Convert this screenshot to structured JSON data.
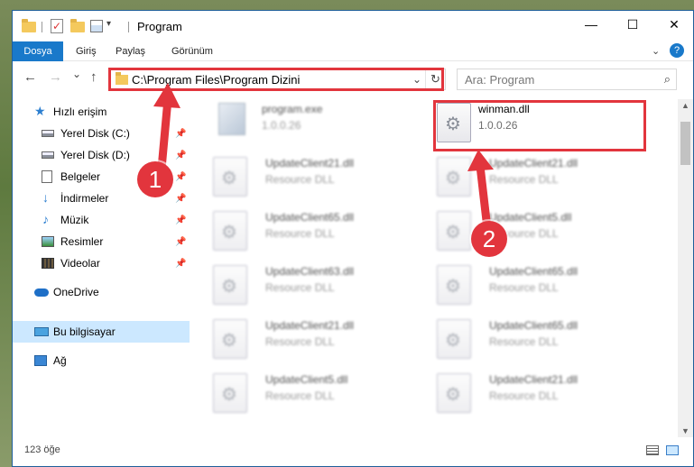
{
  "window": {
    "title": "Program",
    "minimize": "—",
    "maximize": "☐",
    "close": "✕"
  },
  "ribbon": {
    "tabs": [
      "Dosya",
      "Giriş",
      "Paylaş",
      "Görünüm"
    ],
    "help": "?"
  },
  "navigation": {
    "back": "←",
    "forward": "→",
    "recent": "⌄",
    "up": "↑",
    "address": "C:\\Program Files\\Program Dizini",
    "refresh": "↻",
    "search_placeholder": "Ara: Program"
  },
  "sidebar": {
    "items": [
      {
        "label": "Hızlı erişim",
        "icon": "star-icon",
        "pinned": false
      },
      {
        "label": "Yerel Disk (C:)",
        "icon": "drive-icon",
        "pinned": true
      },
      {
        "label": "Yerel Disk (D:)",
        "icon": "drive-icon",
        "pinned": true
      },
      {
        "label": "Belgeler",
        "icon": "document-icon",
        "pinned": true
      },
      {
        "label": "İndirmeler",
        "icon": "download-icon",
        "pinned": true
      },
      {
        "label": "Müzik",
        "icon": "music-icon",
        "pinned": true
      },
      {
        "label": "Resimler",
        "icon": "pictures-icon",
        "pinned": true
      },
      {
        "label": "Videolar",
        "icon": "video-icon",
        "pinned": true
      },
      {
        "label": "OneDrive",
        "icon": "cloud-icon",
        "pinned": false
      },
      {
        "label": "Bu bilgisayar",
        "icon": "computer-icon",
        "pinned": false
      },
      {
        "label": "Ağ",
        "icon": "network-icon",
        "pinned": false
      }
    ]
  },
  "files": [
    {
      "name": "program.exe",
      "sub": "1.0.0.26",
      "type": "exe",
      "blurred": true
    },
    {
      "name": "winman.dll",
      "sub": "1.0.0.26",
      "type": "dll",
      "blurred": false
    },
    {
      "name": "UpdateClient21.dll",
      "sub": "Resource DLL",
      "type": "dll",
      "blurred": true
    },
    {
      "name": "UpdateClient21.dll",
      "sub": "Resource DLL",
      "type": "dll",
      "blurred": true
    },
    {
      "name": "UpdateClient65.dll",
      "sub": "Resource DLL",
      "type": "dll",
      "blurred": true
    },
    {
      "name": "UpdateClient5.dll",
      "sub": "Resource DLL",
      "type": "dll",
      "blurred": true
    },
    {
      "name": "UpdateClient63.dll",
      "sub": "Resource DLL",
      "type": "dll",
      "blurred": true
    },
    {
      "name": "UpdateClient65.dll",
      "sub": "Resource DLL",
      "type": "dll",
      "blurred": true
    },
    {
      "name": "UpdateClient21.dll",
      "sub": "Resource DLL",
      "type": "dll",
      "blurred": true
    },
    {
      "name": "UpdateClient65.dll",
      "sub": "Resource DLL",
      "type": "dll",
      "blurred": true
    },
    {
      "name": "UpdateClient5.dll",
      "sub": "Resource DLL",
      "type": "dll",
      "blurred": true
    },
    {
      "name": "UpdateClient21.dll",
      "sub": "Resource DLL",
      "type": "dll",
      "blurred": true
    }
  ],
  "status": {
    "count": "123 öğe"
  },
  "annotations": {
    "step1": "1",
    "step2": "2",
    "color": "#e2353d"
  },
  "colors": {
    "accent": "#1979ca",
    "selection": "#cce8ff"
  }
}
